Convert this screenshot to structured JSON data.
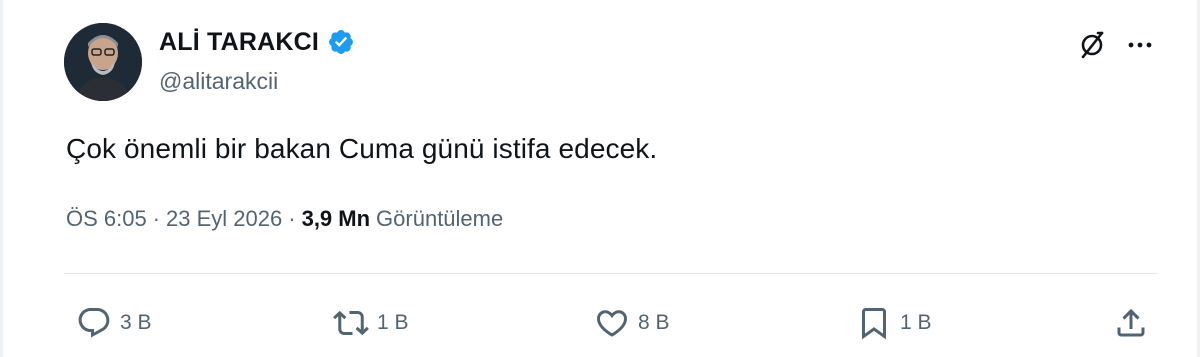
{
  "author": {
    "display_name": "ALİ TARAKCI",
    "handle": "@alitarakcii",
    "verified": true,
    "verified_color": "#1d9bf0"
  },
  "icons": {
    "grok": "grok-icon",
    "more": "more-icon",
    "reply": "reply-icon",
    "retweet": "retweet-icon",
    "like": "heart-icon",
    "bookmark": "bookmark-icon",
    "share": "share-icon"
  },
  "tweet": {
    "text": "Çok önemli bir bakan Cuma günü istifa edecek."
  },
  "meta": {
    "time": "ÖS 6:05",
    "sep1": "·",
    "date": "23 Eyl 2026",
    "sep2": "·",
    "views_count": "3,9 Mn",
    "views_label": "Görüntüleme"
  },
  "actions": {
    "replies": "3 B",
    "retweets": "1 B",
    "likes": "8 B",
    "bookmarks": "1 B"
  }
}
